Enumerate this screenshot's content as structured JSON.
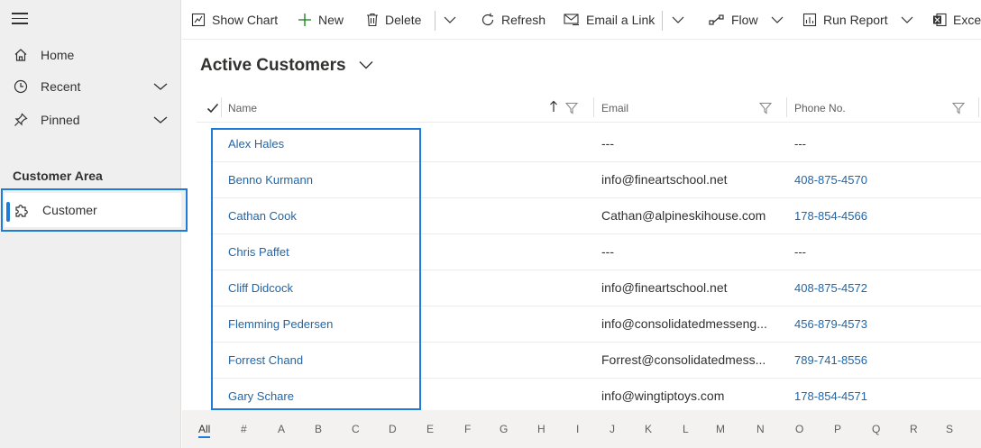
{
  "sidebar": {
    "items": [
      {
        "label": "Home",
        "icon": "home-icon"
      },
      {
        "label": "Recent",
        "icon": "clock-icon"
      },
      {
        "label": "Pinned",
        "icon": "pin-icon"
      }
    ],
    "section_title": "Customer Area",
    "area_item": {
      "label": "Customer",
      "icon": "puzzle-icon"
    }
  },
  "commandbar": {
    "show_chart": "Show Chart",
    "new": "New",
    "delete": "Delete",
    "refresh": "Refresh",
    "email_link": "Email a Link",
    "flow": "Flow",
    "run_report": "Run Report",
    "excel": "Excel"
  },
  "view": {
    "title": "Active Customers"
  },
  "grid": {
    "columns": {
      "name": "Name",
      "email": "Email",
      "phone": "Phone No."
    },
    "rows": [
      {
        "name": "Alex Hales",
        "email": "---",
        "phone": "---"
      },
      {
        "name": "Benno Kurmann",
        "email": "info@fineartschool.net",
        "phone": "408-875-4570"
      },
      {
        "name": "Cathan Cook",
        "email": "Cathan@alpineskihouse.com",
        "phone": "178-854-4566"
      },
      {
        "name": "Chris Paffet",
        "email": "---",
        "phone": "---"
      },
      {
        "name": "Cliff Didcock",
        "email": "info@fineartschool.net",
        "phone": "408-875-4572"
      },
      {
        "name": "Flemming Pedersen",
        "email": "info@consolidatedmesseng...",
        "phone": "456-879-4573"
      },
      {
        "name": "Forrest Chand",
        "email": "Forrest@consolidatedmess...",
        "phone": "789-741-8556"
      },
      {
        "name": "Gary Schare",
        "email": "info@wingtiptoys.com",
        "phone": "178-854-4571"
      }
    ]
  },
  "jumpbar": {
    "letters": [
      "All",
      "#",
      "A",
      "B",
      "C",
      "D",
      "E",
      "F",
      "G",
      "H",
      "I",
      "J",
      "K",
      "L",
      "M",
      "N",
      "O",
      "P",
      "Q",
      "R",
      "S"
    ],
    "active": "All"
  },
  "colors": {
    "accent": "#1e7bd7",
    "link": "#2266a8",
    "sidebar_bg": "#efefef"
  }
}
